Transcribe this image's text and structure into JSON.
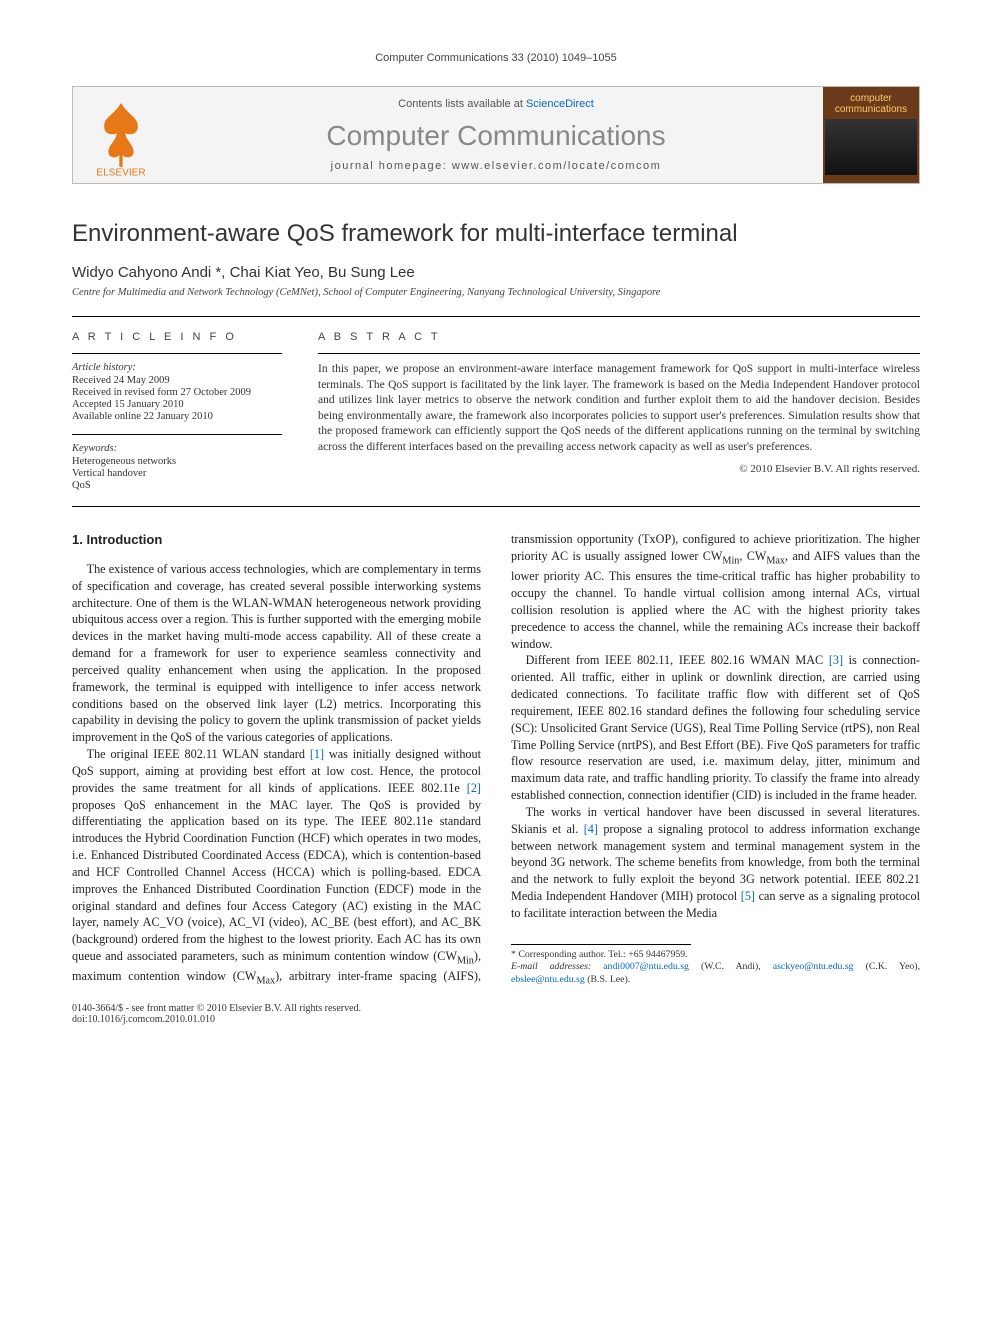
{
  "running_head": "Computer Communications 33 (2010) 1049–1055",
  "banner": {
    "contents_prefix": "Contents lists available at ",
    "contents_link": "ScienceDirect",
    "journal": "Computer Communications",
    "homepage_prefix": "journal homepage: ",
    "homepage": "www.elsevier.com/locate/comcom",
    "publisher": "ELSEVIER",
    "cover_title": "computer communications"
  },
  "article": {
    "title": "Environment-aware QoS framework for multi-interface terminal",
    "authors": "Widyo Cahyono Andi *, Chai Kiat Yeo, Bu Sung Lee",
    "affiliation": "Centre for Multimedia and Network Technology (CeMNet), School of Computer Engineering, Nanyang Technological University, Singapore"
  },
  "info": {
    "label": "A R T I C L E   I N F O",
    "history_label": "Article history:",
    "history": [
      "Received 24 May 2009",
      "Received in revised form 27 October 2009",
      "Accepted 15 January 2010",
      "Available online 22 January 2010"
    ],
    "keywords_label": "Keywords:",
    "keywords": [
      "Heterogeneous networks",
      "Vertical handover",
      "QoS"
    ]
  },
  "abstract": {
    "label": "A B S T R A C T",
    "text": "In this paper, we propose an environment-aware interface management framework for QoS support in multi-interface wireless terminals. The QoS support is facilitated by the link layer. The framework is based on the Media Independent Handover protocol and utilizes link layer metrics to observe the network condition and further exploit them to aid the handover decision. Besides being environmentally aware, the framework also incorporates policies to support user's preferences. Simulation results show that the proposed framework can efficiently support the QoS needs of the different applications running on the terminal by switching across the different interfaces based on the prevailing access network capacity as well as user's preferences.",
    "copyright": "© 2010 Elsevier B.V. All rights reserved."
  },
  "body": {
    "heading": "1. Introduction",
    "p1": "The existence of various access technologies, which are complementary in terms of specification and coverage, has created several possible interworking systems architecture. One of them is the WLAN-WMAN heterogeneous network providing ubiquitous access over a region. This is further supported with the emerging mobile devices in the market having multi-mode access capability. All of these create a demand for a framework for user to experience seamless connectivity and perceived quality enhancement when using the application. In the proposed framework, the terminal is equipped with intelligence to infer access network conditions based on the observed link layer (L2) metrics. Incorporating this capability in devising the policy to govern the uplink transmission of packet yields improvement in the QoS of the various categories of applications.",
    "p2a": "The original IEEE 802.11 WLAN standard ",
    "p2ref1": "[1]",
    "p2b": " was initially designed without QoS support, aiming at providing best effort at low cost. Hence, the protocol provides the same treatment for all kinds of applications. IEEE 802.11e ",
    "p2ref2": "[2]",
    "p2c": " proposes QoS enhancement in the MAC layer. The QoS is provided by differentiating the application based on its type. The IEEE 802.11e standard introduces the Hybrid Coordination Function (HCF) which operates in two modes, i.e. Enhanced Distributed Coordinated Access (EDCA), which is contention-based and HCF Controlled Channel Access (HCCA) which is polling-based. EDCA improves the Enhanced Distributed Coordination Function (EDCF) mode in the original standard and defines four Access Category (AC) existing in the MAC layer, namely AC_VO (voice), AC_VI (video), AC_BE (best effort), and AC_BK (background) ordered from the highest to the lowest priority. Each AC has its own queue and associated parameters, such as minimum contention window (CW",
    "p2min": "Min",
    "p2d": "), maximum contention window (CW",
    "p2max": "Max",
    "p2e": "), arbitrary inter-frame spacing (AIFS), transmission opportunity (TxOP), configured to achieve prioritization. The higher priority AC is usually assigned lower CW",
    "p2min2": "Min",
    "p2f": ", CW",
    "p2max2": "Max",
    "p2g": ", and AIFS values than the lower priority AC. This ensures the time-critical traffic has higher probability to occupy the channel. To handle virtual collision among internal ACs, virtual collision resolution is applied where the AC with the highest priority takes precedence to access the channel, while the remaining ACs increase their backoff window.",
    "p3a": "Different from IEEE 802.11, IEEE 802.16 WMAN MAC ",
    "p3ref3": "[3]",
    "p3b": " is connection-oriented. All traffic, either in uplink or downlink direction, are carried using dedicated connections. To facilitate traffic flow with different set of QoS requirement, IEEE 802.16 standard defines the following four scheduling service (SC): Unsolicited Grant Service (UGS), Real Time Polling Service (rtPS), non Real Time Polling Service (nrtPS), and Best Effort (BE). Five QoS parameters for traffic flow resource reservation are used, i.e. maximum delay, jitter, minimum and maximum data rate, and traffic handling priority. To classify the frame into already established connection, connection identifier (CID) is included in the frame header.",
    "p4a": "The works in vertical handover have been discussed in several literatures. Skianis et al. ",
    "p4ref4": "[4]",
    "p4b": " propose a signaling protocol to address information exchange between network management system and terminal management system in the beyond 3G network. The scheme benefits from knowledge, from both the terminal and the network to fully exploit the beyond 3G network potential. IEEE 802.21 Media Independent Handover (MIH) protocol ",
    "p4ref5": "[5]",
    "p4c": " can serve as a signaling protocol to facilitate interaction between the Media"
  },
  "footnotes": {
    "corr": "* Corresponding author. Tel.: +65 94467959.",
    "emails_label": "E-mail addresses:",
    "e1": "andi0007@ntu.edu.sg",
    "n1": " (W.C. Andi), ",
    "e2": "asckyeo@ntu.edu.sg",
    "n2": " (C.K. Yeo), ",
    "e3": "ebslee@ntu.edu.sg",
    "n3": " (B.S. Lee)."
  },
  "bottom": {
    "left1": "0140-3664/$ - see front matter © 2010 Elsevier B.V. All rights reserved.",
    "left2": "doi:10.1016/j.comcom.2010.01.010"
  }
}
